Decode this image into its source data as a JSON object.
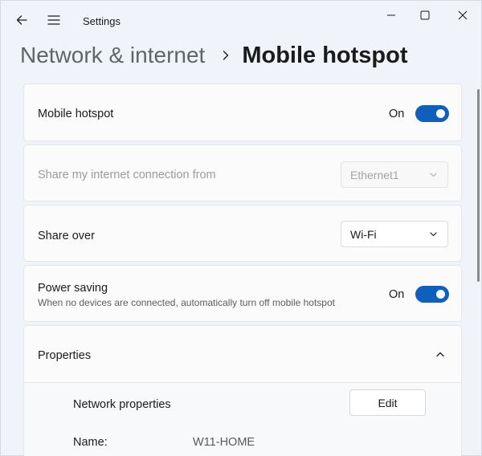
{
  "window": {
    "app_title": "Settings"
  },
  "breadcrumb": {
    "parent": "Network & internet",
    "current": "Mobile hotspot"
  },
  "mobile_hotspot": {
    "label": "Mobile hotspot",
    "state": "On",
    "enabled": true
  },
  "share_from": {
    "label": "Share my internet connection from",
    "value": "Ethernet1",
    "disabled": true
  },
  "share_over": {
    "label": "Share over",
    "value": "Wi-Fi"
  },
  "power_saving": {
    "label": "Power saving",
    "description": "When no devices are connected, automatically turn off mobile hotspot",
    "state": "On",
    "enabled": true
  },
  "properties": {
    "label": "Properties",
    "expanded": true,
    "network_properties_label": "Network properties",
    "edit_label": "Edit",
    "name_label": "Name:",
    "name_value": "W11-HOME"
  },
  "colors": {
    "accent": "#0f5fbd",
    "background": "#f0f3f9",
    "card": "#fbfbfc"
  },
  "icons": [
    "back-arrow-icon",
    "hamburger-menu-icon",
    "minimize-icon",
    "maximize-icon",
    "close-icon",
    "chevron-right-icon",
    "chevron-down-icon",
    "chevron-up-icon"
  ]
}
